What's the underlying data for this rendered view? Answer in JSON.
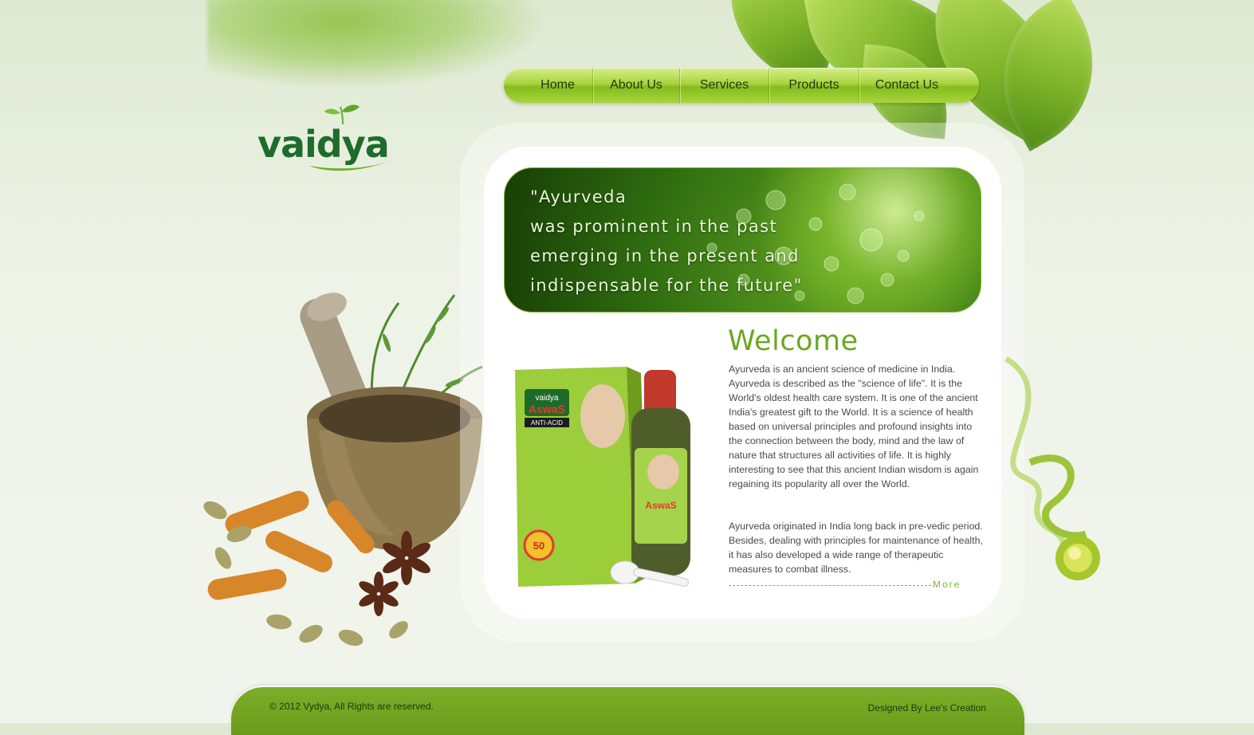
{
  "brand": {
    "name": "vaidya"
  },
  "nav": {
    "items": [
      {
        "label": "Home"
      },
      {
        "label": "About Us"
      },
      {
        "label": "Services"
      },
      {
        "label": "Products"
      },
      {
        "label": "Contact Us"
      }
    ]
  },
  "banner": {
    "quote": "\"Ayurveda\nwas prominent in the past\nemerging in the present and\nindispensable for the future\""
  },
  "welcome": {
    "title": "Welcome",
    "paragraph1": "Ayurveda is an ancient science of medicine in India. Ayurveda is described as the \"science of life\". It is the World's oldest health care system. It is one of the ancient India's greatest gift to the World. It is a science of health based on universal principles and profound insights into the connection between the body, mind and the law of nature that structures all activities of life. It is highly interesting to see that this ancient Indian wisdom is again regaining its popularity all over the World.",
    "paragraph2": "Ayurveda originated in India long back in pre-vedic period. Besides, dealing with principles for maintenance of health, it has also developed a wide range of therapeutic measures to combat illness.",
    "more_label": "More"
  },
  "product": {
    "brand_label": "vaidya",
    "name": "AswaS",
    "subtitle": "ANTI-ACID",
    "badge": "50"
  },
  "footer": {
    "copyright": "© 2012 Vydya, All Rights are reserved.",
    "credit": "Designed By Lee's Creation"
  },
  "colors": {
    "primary_green": "#7fb52a",
    "dark_green": "#1f6b2c",
    "footer_green": "#6a9c1b",
    "text_gray": "#4a4a4a"
  },
  "icons": {
    "logo": "leaf-sprout-icon"
  }
}
